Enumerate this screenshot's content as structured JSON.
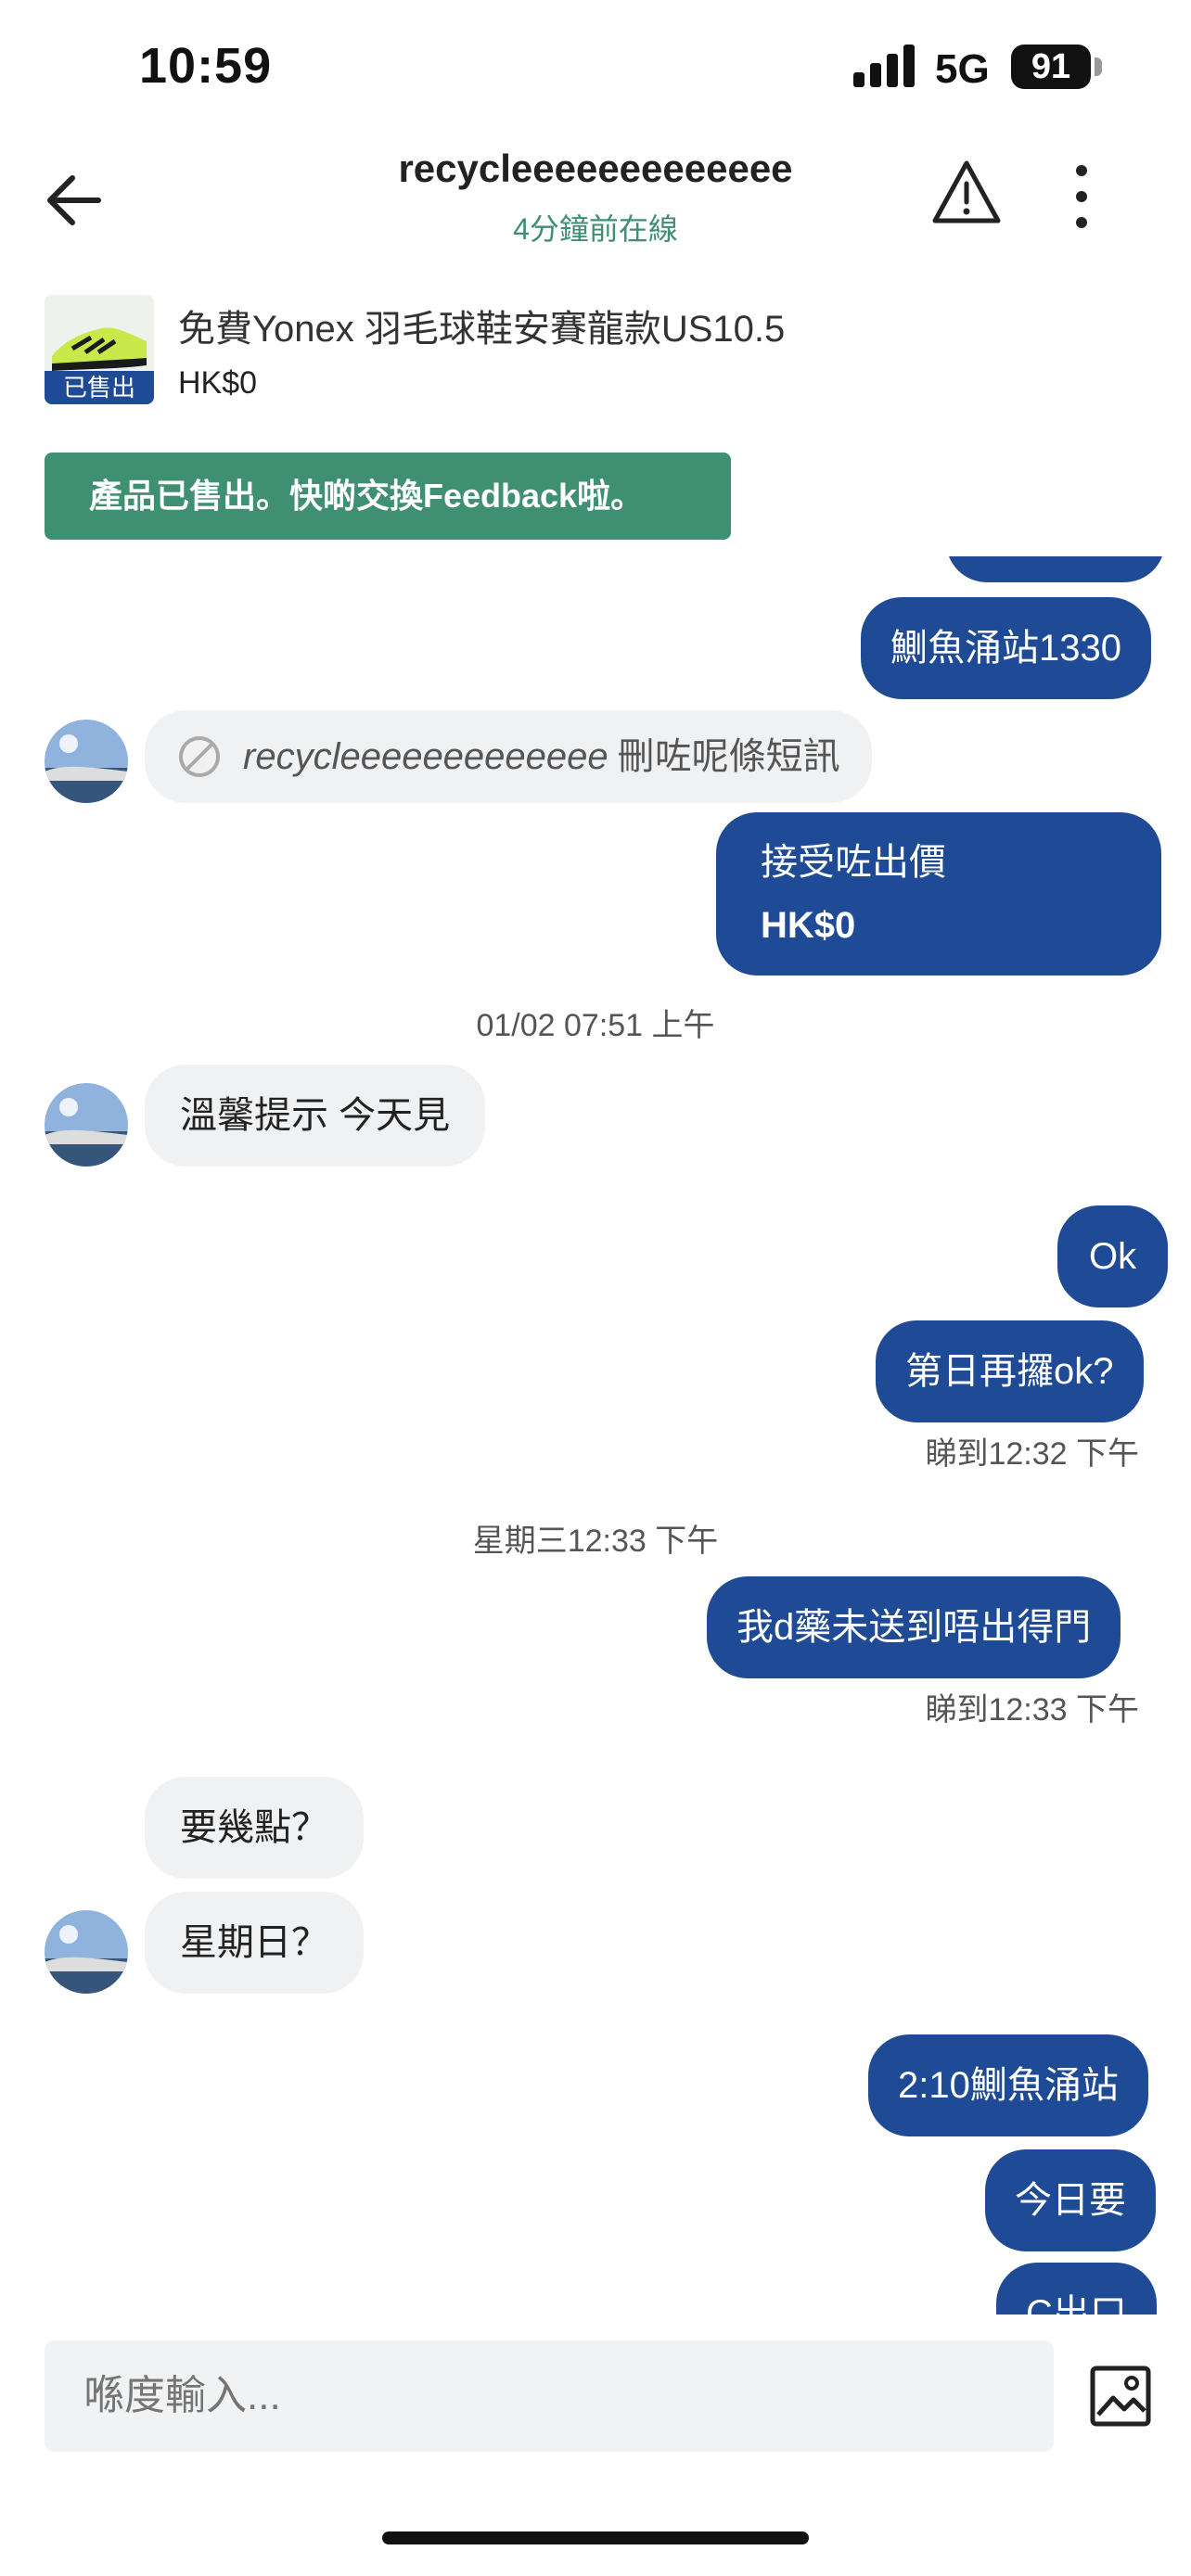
{
  "status": {
    "time": "10:59",
    "network": "5G",
    "battery": "91"
  },
  "header": {
    "title": "recycleeeeeeeeeeeee",
    "subtitle": "4分鐘前在線"
  },
  "product": {
    "title": "免費Yonex 羽毛球鞋安賽龍款US10.5",
    "price": "HK$0",
    "sold_label": "已售出"
  },
  "banner": "產品已售出。快啲交換Feedback啦。",
  "messages": {
    "m1": "鰂魚涌站1330",
    "deleted_user": "recycleeeeeeeeeeeee",
    "deleted_text": "刪咗呢條短訊",
    "offer_title": "接受咗出價",
    "offer_price": "HK$0",
    "ts1": "01/02 07:51 上午",
    "m2": "溫馨提示 今天見",
    "m3": "Ok",
    "m4": "第日再攞ok?",
    "read1": "睇到12:32 下午",
    "ts2": "星期三12:33 下午",
    "m5": "我d藥未送到唔出得門",
    "read2": "睇到12:33 下午",
    "m6": "要幾點？",
    "m7": "星期日？",
    "m8": "2:10鰂魚涌站",
    "m9": "今日要",
    "m10": "C出口"
  },
  "input": {
    "placeholder": "喺度輸入..."
  },
  "colors": {
    "accent": "#1f4b96",
    "green": "#3f8f72",
    "incoming": "#f0f1f2"
  }
}
